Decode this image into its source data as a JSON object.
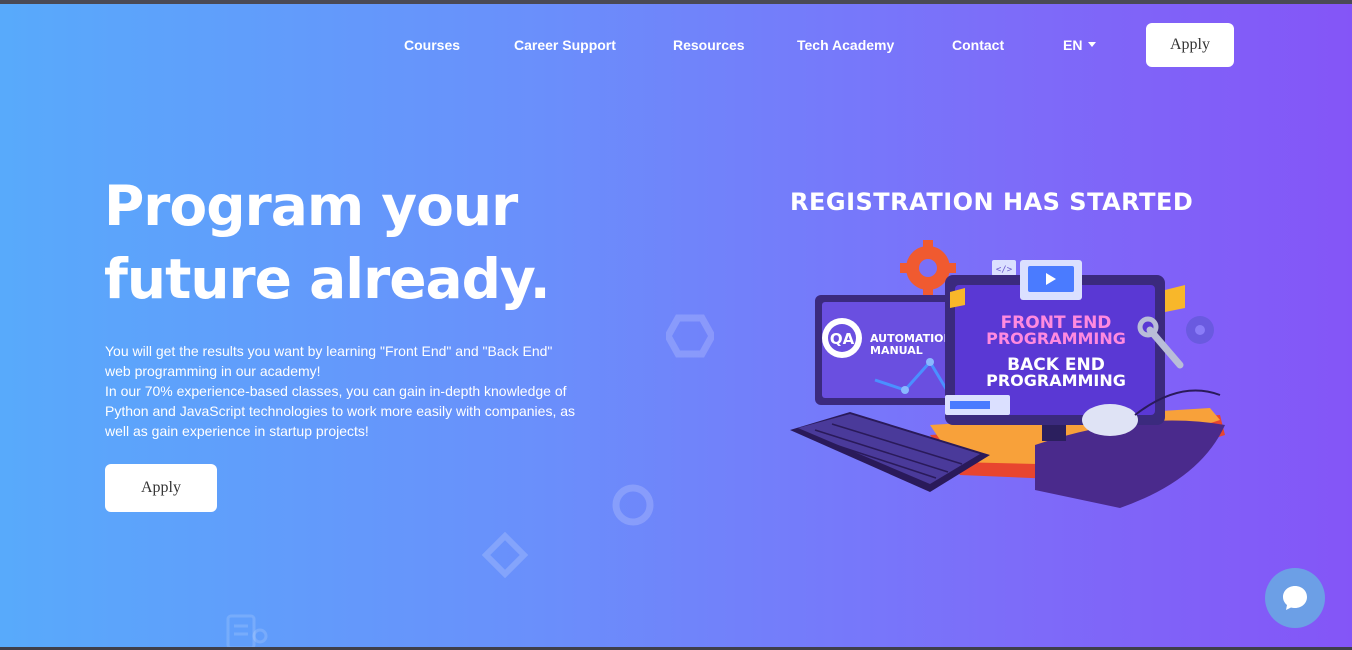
{
  "nav": {
    "items": [
      {
        "label": "Courses"
      },
      {
        "label": "Career Support"
      },
      {
        "label": "Resources"
      },
      {
        "label": "Tech Academy"
      },
      {
        "label": "Contact"
      }
    ],
    "language": "EN",
    "apply_label": "Apply"
  },
  "hero": {
    "title_line1": "Program your",
    "title_line2": "future already.",
    "desc_line1": "You will get the results you want by learning \"Front End\" and \"Back End\" web programming in our academy!",
    "desc_line2": "In our 70% experience-based classes, you can gain in-depth knowledge of Python and JavaScript technologies to work more easily with companies, as well as gain experience in startup projects!",
    "apply_label": "Apply"
  },
  "promo": {
    "title": "REGISTRATION HAS STARTED",
    "left_screen": {
      "badge": "QA",
      "line1": "AUTOMATION",
      "line2": "MANUAL"
    },
    "right_screen": {
      "line1": "FRONT END",
      "line2": "PROGRAMMING",
      "line3": "BACK END",
      "line4": "PROGRAMMING"
    }
  },
  "colors": {
    "gradient_start": "#58aafb",
    "gradient_end": "#8455f7",
    "button_bg": "#ffffff",
    "chat_bg": "#6c9fe6"
  },
  "icons": {
    "chat": "chat-bubble-icon",
    "caret": "chevron-down-icon"
  }
}
